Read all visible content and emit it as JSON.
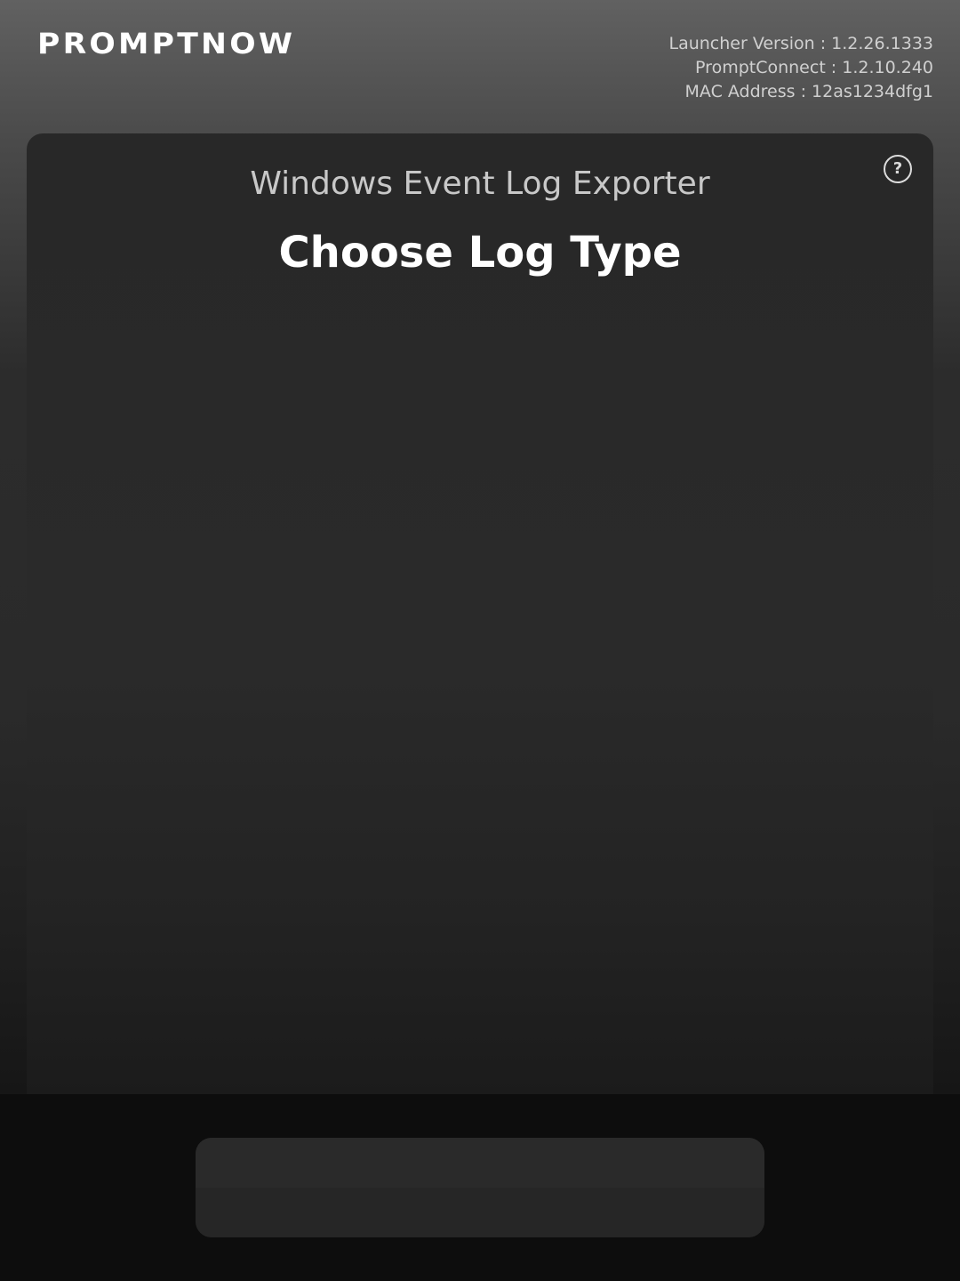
{
  "header": {
    "brand": "PROMPTNOW",
    "launcher_version": "Launcher Version : 1.2.26.1333",
    "prompt_connect": "PromptConnect : 1.2.10.240",
    "mac_address": "MAC Address : 12as1234dfg1"
  },
  "main": {
    "app_title": "Windows Event Log Exporter",
    "screen_title": "Choose Log Type",
    "help_icon": "question-circle-icon",
    "help_glyph": "?"
  },
  "colors": {
    "background_top": "#616161",
    "card": "#2a2a2a",
    "footer": "#0d0d0d",
    "text_primary": "#ffffff",
    "text_secondary": "#c8c8c8"
  }
}
